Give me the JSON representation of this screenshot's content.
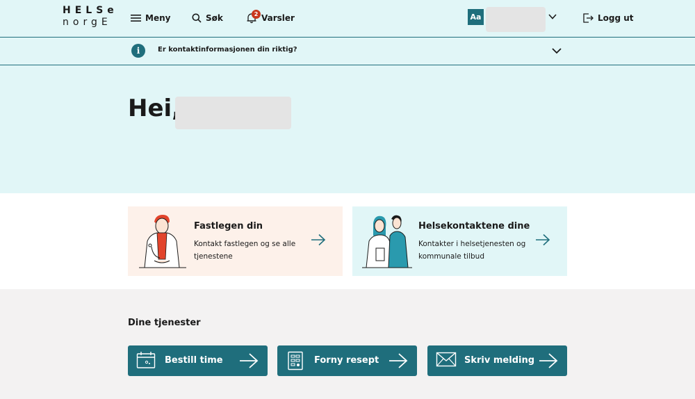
{
  "header": {
    "logo_row1": "HELSe",
    "logo_row2": "norgE",
    "menu_label": "Meny",
    "search_label": "Søk",
    "alerts_label": "Varsler",
    "alerts_count": "2",
    "font_size_label": "Aa",
    "logout_label": "Logg ut"
  },
  "infobar": {
    "text": "Er kontaktinformasjonen din riktig?"
  },
  "hero": {
    "greeting": "Hei,"
  },
  "cards": [
    {
      "title": "Fastlegen din",
      "desc": "Kontakt fastlegen og se alle tjenestene"
    },
    {
      "title": "Helsekontaktene dine",
      "desc": "Kontakter i helsetjenesten og kommunale tilbud"
    }
  ],
  "services": {
    "title": "Dine tjenester",
    "items": [
      {
        "label": "Bestill time",
        "icon": "calendar-icon"
      },
      {
        "label": "Forny resept",
        "icon": "prescription-icon"
      },
      {
        "label": "Skriv melding",
        "icon": "envelope-icon"
      }
    ]
  },
  "colors": {
    "primary": "#1f6e7c",
    "hero_bg": "#e1f6f7",
    "card_warm": "#fdf1ea",
    "badge": "#c8371d",
    "page_bg": "#f3f2f2"
  }
}
